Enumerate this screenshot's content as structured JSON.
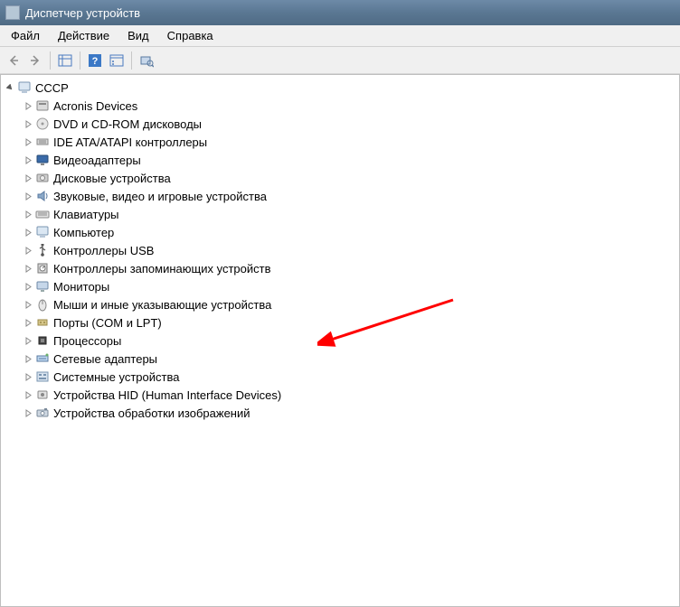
{
  "window": {
    "title": "Диспетчер устройств"
  },
  "menu": {
    "items": [
      {
        "label": "Файл"
      },
      {
        "label": "Действие"
      },
      {
        "label": "Вид"
      },
      {
        "label": "Справка"
      }
    ]
  },
  "tree": {
    "root": {
      "label": "CCCP",
      "expanded": true
    },
    "nodes": [
      {
        "label": "Acronis Devices",
        "icon": "generic"
      },
      {
        "label": "DVD и CD-ROM дисководы",
        "icon": "disc"
      },
      {
        "label": "IDE ATA/ATAPI контроллеры",
        "icon": "ide"
      },
      {
        "label": "Видеоадаптеры",
        "icon": "display"
      },
      {
        "label": "Дисковые устройства",
        "icon": "drive"
      },
      {
        "label": "Звуковые, видео и игровые устройства",
        "icon": "sound"
      },
      {
        "label": "Клавиатуры",
        "icon": "keyboard"
      },
      {
        "label": "Компьютер",
        "icon": "computer"
      },
      {
        "label": "Контроллеры USB",
        "icon": "usb"
      },
      {
        "label": "Контроллеры запоминающих устройств",
        "icon": "storage"
      },
      {
        "label": "Мониторы",
        "icon": "monitor"
      },
      {
        "label": "Мыши и иные указывающие устройства",
        "icon": "mouse"
      },
      {
        "label": "Порты (COM и LPT)",
        "icon": "port"
      },
      {
        "label": "Процессоры",
        "icon": "cpu"
      },
      {
        "label": "Сетевые адаптеры",
        "icon": "network"
      },
      {
        "label": "Системные устройства",
        "icon": "system"
      },
      {
        "label": "Устройства HID (Human Interface Devices)",
        "icon": "hid"
      },
      {
        "label": "Устройства обработки изображений",
        "icon": "imaging"
      }
    ]
  }
}
